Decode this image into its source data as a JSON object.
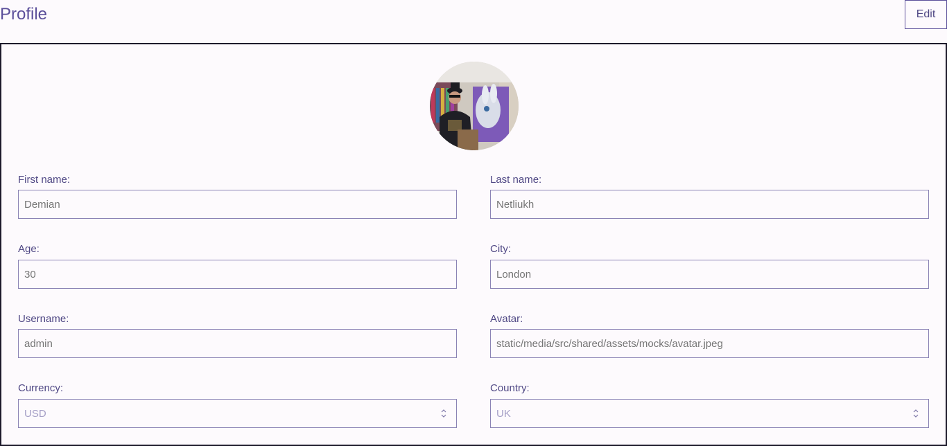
{
  "header": {
    "title": "Profile",
    "edit_label": "Edit"
  },
  "profile": {
    "avatar_icon": "user-photo",
    "first_name": {
      "label": "First name:",
      "placeholder": "Demian"
    },
    "last_name": {
      "label": "Last name:",
      "placeholder": "Netliukh"
    },
    "age": {
      "label": "Age:",
      "placeholder": "30"
    },
    "city": {
      "label": "City:",
      "placeholder": "London"
    },
    "username": {
      "label": "Username:",
      "placeholder": "admin"
    },
    "avatar": {
      "label": "Avatar:",
      "placeholder": "static/media/src/shared/assets/mocks/avatar.jpeg"
    },
    "currency": {
      "label": "Currency:",
      "value": "USD"
    },
    "country": {
      "label": "Country:",
      "value": "UK"
    }
  },
  "colors": {
    "accent": "#5b4f9a",
    "text": "#4f4784",
    "placeholder": "#a59fc6",
    "background": "#fdfafd",
    "border": "#8b83b5"
  }
}
